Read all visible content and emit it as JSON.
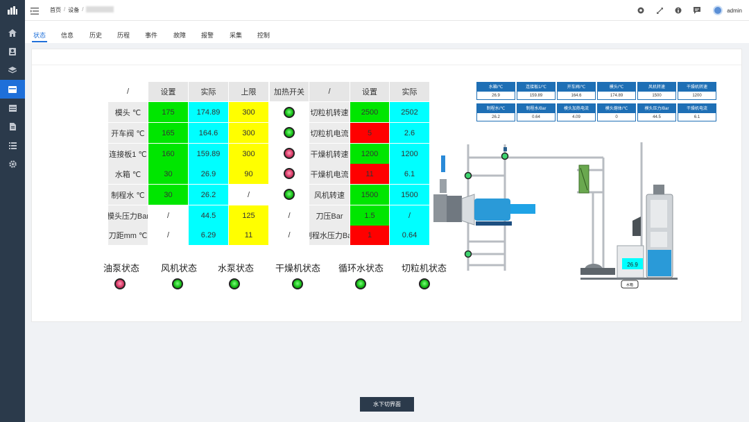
{
  "sidebar": {
    "logo": "bar-chart-logo",
    "items": [
      {
        "icon": "home-icon"
      },
      {
        "icon": "id-card-icon"
      },
      {
        "icon": "layers-icon"
      },
      {
        "icon": "equipment-icon",
        "active": true
      },
      {
        "icon": "table-icon"
      },
      {
        "icon": "document-icon"
      },
      {
        "icon": "list-icon"
      },
      {
        "icon": "gear-icon"
      }
    ]
  },
  "topbar": {
    "breadcrumb": [
      "首页",
      "设备"
    ],
    "user": "admin",
    "icons": [
      "github-icon",
      "fullscreen-icon",
      "info-icon",
      "message-icon"
    ]
  },
  "tabs": [
    "状态",
    "信息",
    "历史",
    "历程",
    "事件",
    "故障",
    "报警",
    "采集",
    "控制"
  ],
  "active_tab": 0,
  "left_table": {
    "headers": [
      "/",
      "设置",
      "实际",
      "上限",
      "加热开关"
    ],
    "rows": [
      {
        "label": "模头 ℃",
        "set": "175",
        "actual": "174.89",
        "limit": "300",
        "heat": "on"
      },
      {
        "label": "开车阀 ℃",
        "set": "165",
        "actual": "164.6",
        "limit": "300",
        "heat": "on"
      },
      {
        "label": "连接板1 ℃",
        "set": "160",
        "actual": "159.89",
        "limit": "300",
        "heat": "off"
      },
      {
        "label": "水箱 ℃",
        "set": "30",
        "actual": "26.9",
        "limit": "90",
        "heat": "off"
      },
      {
        "label": "制程水 ℃",
        "set": "30",
        "actual": "26.2",
        "limit": "/",
        "heat": "on"
      },
      {
        "label": "模头压力Bar",
        "set": "/",
        "actual": "44.5",
        "limit": "125",
        "heat": "/"
      },
      {
        "label": "刀距mm ℃",
        "set": "/",
        "actual": "6.29",
        "limit": "11",
        "heat": "/"
      }
    ]
  },
  "right_table": {
    "headers": [
      "/",
      "设置",
      "实际"
    ],
    "rows": [
      {
        "label": "切粒机转速",
        "set": "2500",
        "actual": "2502",
        "set_color": "green"
      },
      {
        "label": "切粒机电流",
        "set": "5",
        "actual": "2.6",
        "set_color": "red"
      },
      {
        "label": "干燥机转速",
        "set": "1200",
        "actual": "1200",
        "set_color": "green"
      },
      {
        "label": "干燥机电流",
        "set": "11",
        "actual": "6.1",
        "set_color": "red"
      },
      {
        "label": "风机转速",
        "set": "1500",
        "actual": "1500",
        "set_color": "green"
      },
      {
        "label": "刀压Bar",
        "set": "1.5",
        "actual": "/",
        "set_color": "green"
      },
      {
        "label": "制程水压力Bar",
        "set": "1",
        "actual": "0.64",
        "set_color": "red"
      }
    ]
  },
  "status_items": [
    {
      "label": "油泵状态",
      "state": "off"
    },
    {
      "label": "风机状态",
      "state": "on"
    },
    {
      "label": "水泵状态",
      "state": "on"
    },
    {
      "label": "干燥机状态",
      "state": "on"
    },
    {
      "label": "循环水状态",
      "state": "on"
    },
    {
      "label": "切粒机状态",
      "state": "on"
    }
  ],
  "mini_table": [
    {
      "label": "水箱/℃",
      "value": "26.9"
    },
    {
      "label": "连接板1/℃",
      "value": "159.89"
    },
    {
      "label": "开车阀/℃",
      "value": "164.6"
    },
    {
      "label": "模头/℃",
      "value": "174.89"
    },
    {
      "label": "风机转速",
      "value": "1500"
    },
    {
      "label": "干燥机转速",
      "value": "1200"
    },
    {
      "label": "制程水/℃",
      "value": "26.2"
    },
    {
      "label": "制程水/Bar",
      "value": "0.64"
    },
    {
      "label": "模头加热电流",
      "value": "4.09"
    },
    {
      "label": "模头熔体/℃",
      "value": "0"
    },
    {
      "label": "模头压力/Bar",
      "value": "44.5"
    },
    {
      "label": "干燥机电流",
      "value": "6.1"
    }
  ],
  "diagram": {
    "tank_temp": "26.9",
    "tank_label": "水箱"
  },
  "switch_button": "水下切界面",
  "colors": {
    "sidebar": "#2b3a4b",
    "accent": "#1e6fd9",
    "green": "#00e600",
    "cyan": "#00ffff",
    "yellow": "#ffff00",
    "red": "#ff0000"
  }
}
